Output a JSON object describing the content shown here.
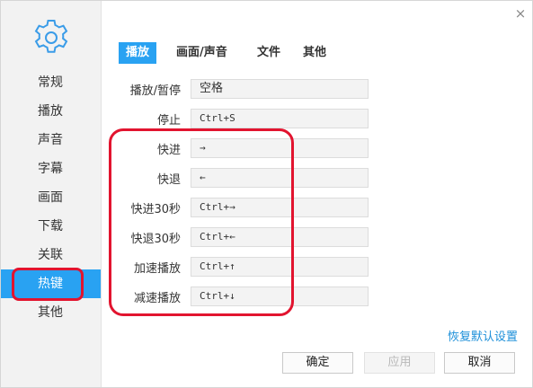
{
  "colors": {
    "accent": "#29a2f2",
    "highlight": "#e2142f",
    "link": "#1c8fd9"
  },
  "icons": {
    "settings": "gear-icon",
    "close": "close-icon"
  },
  "close_glyph": "×",
  "sidebar": {
    "items": [
      {
        "label": "常规"
      },
      {
        "label": "播放"
      },
      {
        "label": "声音"
      },
      {
        "label": "字幕"
      },
      {
        "label": "画面"
      },
      {
        "label": "下载"
      },
      {
        "label": "关联"
      },
      {
        "label": "热键",
        "selected": true
      },
      {
        "label": "其他"
      }
    ]
  },
  "tabs": [
    {
      "label": "播放",
      "selected": true
    },
    {
      "label": "画面/声音"
    },
    {
      "label": "文件"
    },
    {
      "label": "其他"
    }
  ],
  "hotkeys": [
    {
      "label": "播放/暂停",
      "value": "空格"
    },
    {
      "label": "停止",
      "value": "Ctrl+S"
    },
    {
      "label": "快进",
      "value": "→"
    },
    {
      "label": "快退",
      "value": "←"
    },
    {
      "label": "快进30秒",
      "value": "Ctrl+→"
    },
    {
      "label": "快退30秒",
      "value": "Ctrl+←"
    },
    {
      "label": "加速播放",
      "value": "Ctrl+↑"
    },
    {
      "label": "减速播放",
      "value": "Ctrl+↓"
    }
  ],
  "restore_defaults": "恢复默认设置",
  "buttons": {
    "ok": "确定",
    "apply": "应用",
    "cancel": "取消"
  }
}
